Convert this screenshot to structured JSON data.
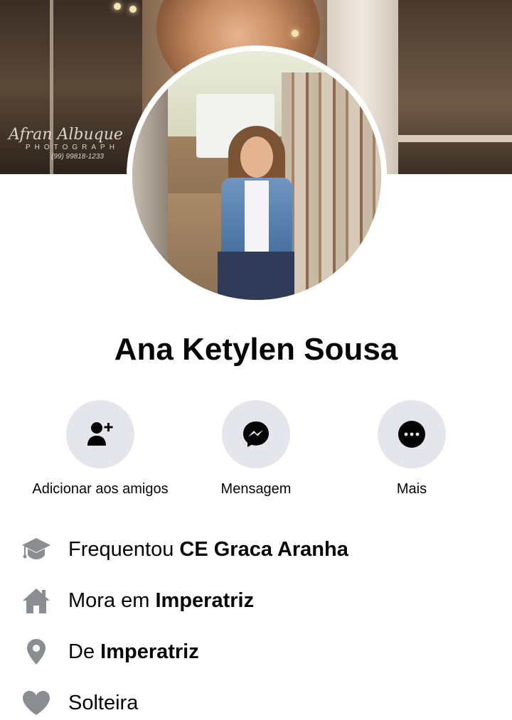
{
  "cover": {
    "watermark_name": "Afran Albuque",
    "watermark_sub": "PHOTOGRAPH",
    "watermark_phone": "(99) 99818-1233"
  },
  "profile": {
    "name": "Ana Ketylen Sousa"
  },
  "actions": {
    "add_friend": {
      "label": "Adicionar aos amigos",
      "icon": "add-friend-icon"
    },
    "message": {
      "label": "Mensagem",
      "icon": "messenger-icon"
    },
    "more": {
      "label": "Mais",
      "icon": "more-icon"
    }
  },
  "intro": {
    "school": {
      "prefix": "Frequentou ",
      "value": "CE Graca Aranha",
      "icon": "education-icon"
    },
    "lives_in": {
      "prefix": "Mora em ",
      "value": "Imperatriz",
      "icon": "home-icon"
    },
    "from": {
      "prefix": "De ",
      "value": "Imperatriz",
      "icon": "location-pin-icon"
    },
    "relationship": {
      "prefix": "Solteira",
      "value": "",
      "icon": "heart-icon"
    }
  },
  "colors": {
    "button_bg": "#e4e6eb",
    "icon_dark": "#050505",
    "icon_gray": "#8a8d91",
    "text": "#050505"
  }
}
